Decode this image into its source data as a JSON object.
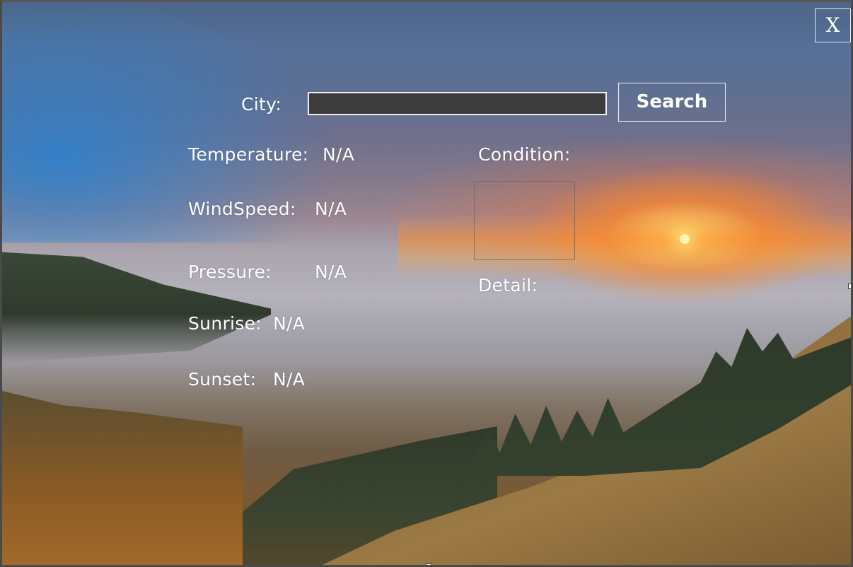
{
  "window": {
    "close_label": "X"
  },
  "search": {
    "city_label": "City:",
    "city_value": "",
    "city_placeholder": "",
    "button_label": "Search"
  },
  "weather": {
    "temperature_label": "Temperature:",
    "temperature_value": "N/A",
    "windspeed_label": "WindSpeed:",
    "windspeed_value": "N/A",
    "pressure_label": "Pressure:",
    "pressure_value": "N/A",
    "sunrise_label": "Sunrise:",
    "sunrise_value": "N/A",
    "sunset_label": "Sunset:",
    "sunset_value": "N/A",
    "condition_label": "Condition:",
    "detail_label": "Detail:"
  },
  "colors": {
    "text": "#ffffff",
    "input_background": "#3c3c3c",
    "border": "#f0f0f0"
  }
}
